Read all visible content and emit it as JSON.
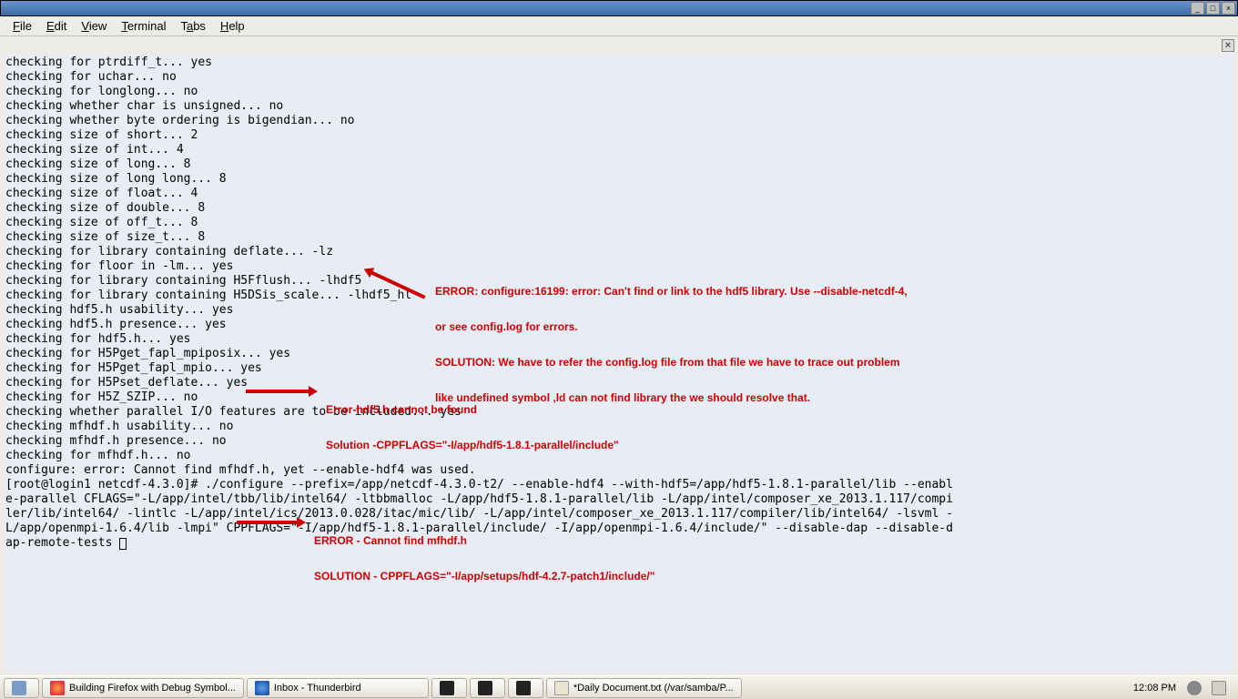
{
  "titlebar": {
    "min": "_",
    "max": "□",
    "close": "×"
  },
  "menu": {
    "file": "File",
    "edit": "Edit",
    "view": "View",
    "terminal": "Terminal",
    "tabs": "Tabs",
    "help": "Help"
  },
  "tabclose": "×",
  "term_lines": [
    "checking for ptrdiff_t... yes",
    "checking for uchar... no",
    "checking for longlong... no",
    "checking whether char is unsigned... no",
    "checking whether byte ordering is bigendian... no",
    "checking size of short... 2",
    "checking size of int... 4",
    "checking size of long... 8",
    "checking size of long long... 8",
    "checking size of float... 4",
    "checking size of double... 8",
    "checking size of off_t... 8",
    "checking size of size_t... 8",
    "checking for library containing deflate... -lz",
    "checking for floor in -lm... yes",
    "checking for library containing H5Fflush... -lhdf5",
    "checking for library containing H5DSis_scale... -lhdf5_hl",
    "checking hdf5.h usability... yes",
    "checking hdf5.h presence... yes",
    "checking for hdf5.h... yes",
    "checking for H5Pget_fapl_mpiposix... yes",
    "checking for H5Pget_fapl_mpio... yes",
    "checking for H5Pset_deflate... yes",
    "checking for H5Z_SZIP... no",
    "checking whether parallel I/O features are to be included... yes",
    "checking mfhdf.h usability... no",
    "checking mfhdf.h presence... no",
    "checking for mfhdf.h... no",
    "configure: error: Cannot find mfhdf.h, yet --enable-hdf4 was used.",
    "[root@login1 netcdf-4.3.0]# ./configure --prefix=/app/netcdf-4.3.0-t2/ --enable-hdf4 --with-hdf5=/app/hdf5-1.8.1-parallel/lib --enabl",
    "e-parallel CFLAGS=\"-L/app/intel/tbb/lib/intel64/ -ltbbmalloc -L/app/hdf5-1.8.1-parallel/lib -L/app/intel/composer_xe_2013.1.117/compi",
    "ler/lib/intel64/ -lintlc -L/app/intel/ics/2013.0.028/itac/mic/lib/ -L/app/intel/composer_xe_2013.1.117/compiler/lib/intel64/ -lsvml -",
    "L/app/openmpi-1.6.4/lib -lmpi\" CPPFLAGS=\"-I/app/hdf5-1.8.1-parallel/include/ -I/app/openmpi-1.6.4/include/\" --disable-dap --disable-d",
    "ap-remote-tests "
  ],
  "annot1": {
    "l1": "ERROR: configure:16199: error: Can't find or link to the hdf5 library. Use --disable-netcdf-4,",
    "l2": "or see config.log for errors.",
    "l3": "SOLUTION: We have to refer the config.log file from that file we have to trace out problem",
    "l4": "like undefined symbol ,ld can not find library the we should resolve that."
  },
  "annot2": {
    "l1": "Error-hdf5.h cannot be found",
    "l2": "Solution -CPPFLAGS=\"-I/app/hdf5-1.8.1-parallel/include\""
  },
  "annot3": {
    "l1": "ERROR - Cannot find mfhdf.h",
    "l2": "SOLUTION - CPPFLAGS=\"-I/app/setups/hdf-4.2.7-patch1/include/\""
  },
  "taskbar": {
    "app1": "Building Firefox with Debug Symbol...",
    "app2": "Inbox - Thunderbird",
    "app3": "*Daily Document.txt  (/var/samba/P...",
    "clock": "12:08 PM"
  }
}
